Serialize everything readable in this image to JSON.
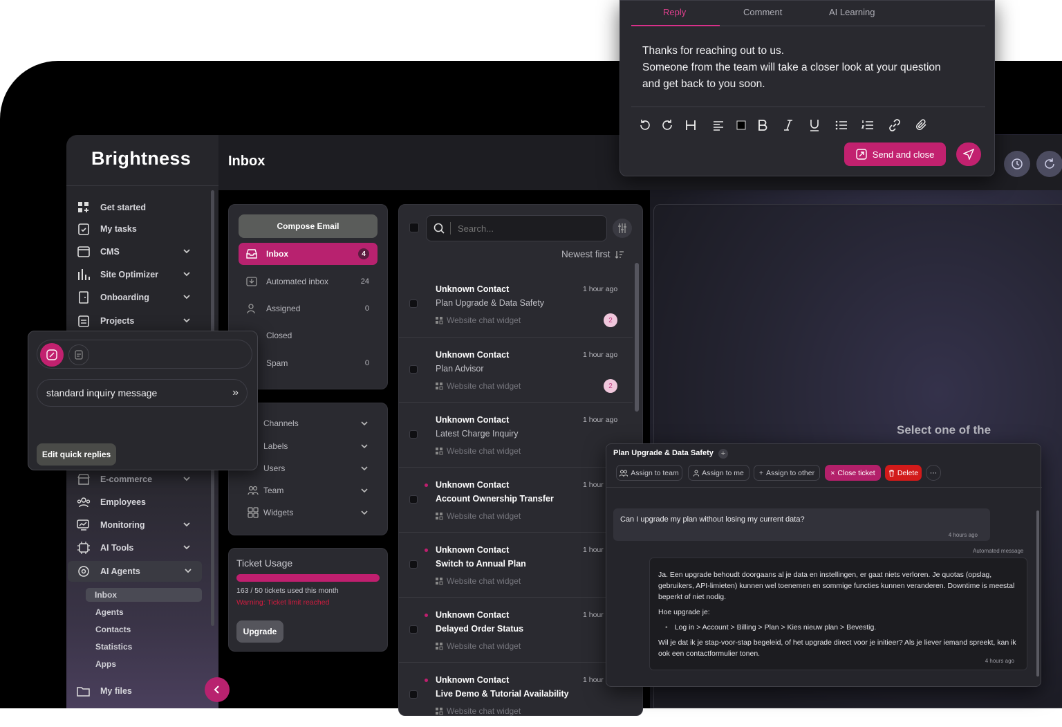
{
  "app": {
    "logo": "Brightness",
    "page_title": "Inbox"
  },
  "sidebar": {
    "items": [
      {
        "label": "Get started",
        "icon": "grid-icon"
      },
      {
        "label": "My tasks",
        "icon": "clipboard-check-icon"
      },
      {
        "label": "CMS",
        "icon": "browser-icon"
      },
      {
        "label": "Site Optimizer",
        "icon": "bar-chart-icon"
      },
      {
        "label": "Onboarding",
        "icon": "door-icon"
      },
      {
        "label": "Projects",
        "icon": "clipboard-icon"
      },
      {
        "label": "E-commerce",
        "icon": "store-icon"
      },
      {
        "label": "Employees",
        "icon": "users-icon"
      },
      {
        "label": "Monitoring",
        "icon": "monitor-icon"
      },
      {
        "label": "AI Tools",
        "icon": "chip-icon"
      },
      {
        "label": "AI Agents",
        "icon": "gear-brain-icon"
      }
    ],
    "subitems": [
      "Inbox",
      "Agents",
      "Contacts",
      "Statistics",
      "Apps"
    ],
    "bottom": {
      "label": "My files"
    }
  },
  "mailbox": {
    "compose": "Compose Email",
    "folders": [
      {
        "label": "Inbox",
        "count": "4"
      },
      {
        "label": "Automated inbox",
        "count": "24"
      },
      {
        "label": "Assigned",
        "count": "0"
      },
      {
        "label": "Closed",
        "count": ""
      },
      {
        "label": "Spam",
        "count": "0"
      }
    ],
    "sections": [
      "Channels",
      "Labels",
      "Users",
      "Team",
      "Widgets"
    ],
    "usage": {
      "title": "Ticket Usage",
      "progress": 1.0,
      "text": "163 / 50 tickets used this month",
      "warning": "Warning: Ticket limit reached",
      "upgrade": "Upgrade"
    }
  },
  "list": {
    "search_placeholder": "Search...",
    "sort": "Newest first",
    "messages": [
      {
        "name": "Unknown Contact",
        "subject": "Plan Upgrade & Data Safety",
        "source": "Website chat widget",
        "time": "1 hour ago",
        "badge": "2",
        "unread": false
      },
      {
        "name": "Unknown Contact",
        "subject": "Plan Advisor",
        "source": "Website chat widget",
        "time": "1 hour ago",
        "badge": "2",
        "unread": false
      },
      {
        "name": "Unknown Contact",
        "subject": "Latest Charge Inquiry",
        "source": "Website chat widget",
        "time": "1 hour ago",
        "badge": "",
        "unread": false
      },
      {
        "name": "Unknown Contact",
        "subject": "Account Ownership Transfer",
        "source": "Website chat widget",
        "time": "1 hour",
        "badge": "",
        "unread": true
      },
      {
        "name": "Unknown Contact",
        "subject": "Switch to Annual Plan",
        "source": "Website chat widget",
        "time": "1 hour",
        "badge": "",
        "unread": true
      },
      {
        "name": "Unknown Contact",
        "subject": "Delayed Order Status",
        "source": "Website chat widget",
        "time": "1 hour",
        "badge": "",
        "unread": true
      },
      {
        "name": "Unknown Contact",
        "subject": "Live Demo & Tutorial Availability",
        "source": "Website chat widget",
        "time": "1 hour",
        "badge": "",
        "unread": true
      }
    ]
  },
  "detail": {
    "placeholder": "Select one of the"
  },
  "reply": {
    "tabs": [
      "Reply",
      "Comment",
      "AI Learning"
    ],
    "lines": [
      "Thanks for reaching out to us.",
      "Someone from the team will take a closer look at your question",
      "and get back to you soon."
    ],
    "send": "Send and close"
  },
  "quick_replies": {
    "item": "standard inquiry message",
    "edit": "Edit quick replies"
  },
  "ticket": {
    "title": "Plan Upgrade & Data Safety",
    "actions": {
      "assign_team": "Assign to team",
      "assign_me": "Assign to me",
      "assign_other": "Assign to other",
      "close": "Close ticket",
      "delete": "Delete"
    },
    "question": "Can I upgrade my plan without losing my current data?",
    "question_time": "4 hours ago",
    "auto_label": "Automated message",
    "answer_p1": "Ja. Een upgrade behoudt doorgaans al je data en instellingen, er gaat niets verloren. Je quotas (opslag, gebruikers, API-limieten) kunnen wel toenemen en sommige functies kunnen veranderen. Downtime is meestal beperkt of niet nodig.",
    "answer_p2": "Hoe upgrade je:",
    "answer_step": "Log in > Account > Billing > Plan > Kies nieuw plan > Bevestig.",
    "answer_p3": "Wil je dat ik je stap-voor-stap begeleid, of het upgrade direct voor je initieer? Als je liever iemand spreekt, kan ik ook een contactformulier tonen.",
    "answer_time": "4 hours ago"
  }
}
